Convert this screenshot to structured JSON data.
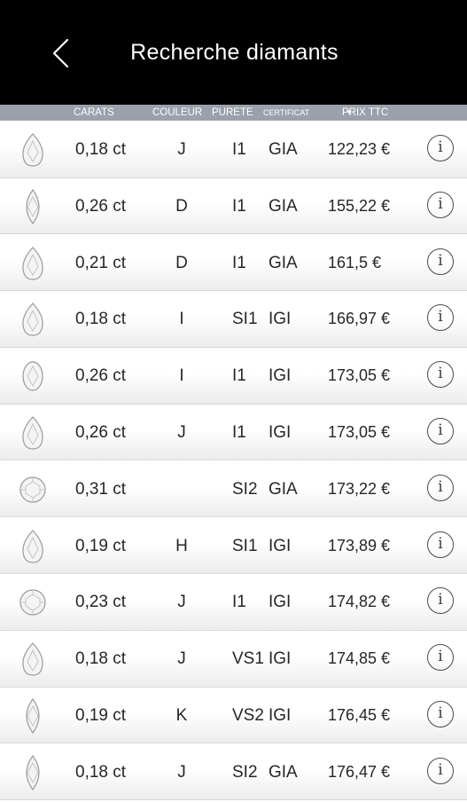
{
  "header": {
    "title": "Recherche diamants",
    "back_icon": "chevron-left-icon"
  },
  "columns": {
    "carats": "CARATS",
    "couleur": "COULEUR",
    "purete": "PURETE",
    "certificat": "CERTIFICAT",
    "prix": "PRIX TTC",
    "sort_indicator": "▼"
  },
  "colors": {
    "header_bg": "#000000",
    "column_bar_bg": "#9aa1ab"
  },
  "rows": [
    {
      "shape": "pear",
      "carat": "0,18 ct",
      "color": "J",
      "clarity": "I1",
      "cert": "GIA",
      "price": "122,23 €"
    },
    {
      "shape": "marquise",
      "carat": "0,26 ct",
      "color": "D",
      "clarity": "I1",
      "cert": "GIA",
      "price": "155,22 €"
    },
    {
      "shape": "pear",
      "carat": "0,21 ct",
      "color": "D",
      "clarity": "I1",
      "cert": "GIA",
      "price": "161,5 €"
    },
    {
      "shape": "pear",
      "carat": "0,18 ct",
      "color": "I",
      "clarity": "SI1",
      "cert": "IGI",
      "price": "166,97 €"
    },
    {
      "shape": "oval",
      "carat": "0,26 ct",
      "color": "I",
      "clarity": "I1",
      "cert": "IGI",
      "price": "173,05 €"
    },
    {
      "shape": "pear",
      "carat": "0,26 ct",
      "color": "J",
      "clarity": "I1",
      "cert": "IGI",
      "price": "173,05 €"
    },
    {
      "shape": "round",
      "carat": "0,31 ct",
      "color": "",
      "clarity": "SI2",
      "cert": "GIA",
      "price": "173,22 €"
    },
    {
      "shape": "pear",
      "carat": "0,19 ct",
      "color": "H",
      "clarity": "SI1",
      "cert": "IGI",
      "price": "173,89 €"
    },
    {
      "shape": "round",
      "carat": "0,23 ct",
      "color": "J",
      "clarity": "I1",
      "cert": "IGI",
      "price": "174,82 €"
    },
    {
      "shape": "pear",
      "carat": "0,18 ct",
      "color": "J",
      "clarity": "VS1",
      "cert": "IGI",
      "price": "174,85 €"
    },
    {
      "shape": "marquise",
      "carat": "0,19 ct",
      "color": "K",
      "clarity": "VS2",
      "cert": "IGI",
      "price": "176,45 €"
    },
    {
      "shape": "marquise",
      "carat": "0,18 ct",
      "color": "J",
      "clarity": "SI2",
      "cert": "GIA",
      "price": "176,47 €"
    }
  ],
  "info_icon": "info-circle-icon",
  "info_glyph": "i"
}
